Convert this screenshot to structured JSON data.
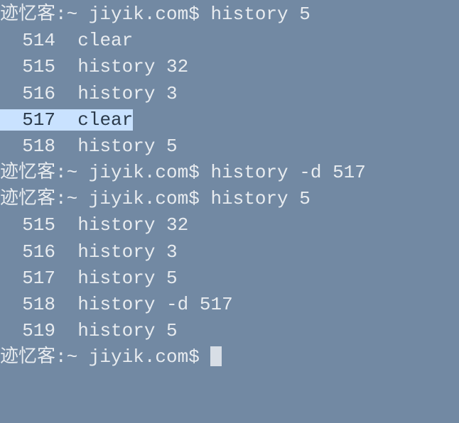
{
  "prompt": {
    "user": "迹忆客",
    "sep1": ":~ ",
    "host": "jiyik.com",
    "sep2": "$ "
  },
  "lines": [
    {
      "type": "cmd",
      "command": "history 5"
    },
    {
      "type": "hist",
      "num": "  514",
      "cmd": "clear",
      "highlight": false
    },
    {
      "type": "hist",
      "num": "  515",
      "cmd": "history 32",
      "highlight": false
    },
    {
      "type": "hist",
      "num": "  516",
      "cmd": "history 3",
      "highlight": false
    },
    {
      "type": "hist",
      "num": "  517",
      "cmd": "clear",
      "highlight": true
    },
    {
      "type": "hist",
      "num": "  518",
      "cmd": "history 5",
      "highlight": false
    },
    {
      "type": "cmd",
      "command": "history -d 517"
    },
    {
      "type": "cmd",
      "command": "history 5"
    },
    {
      "type": "hist",
      "num": "  515",
      "cmd": "history 32",
      "highlight": false
    },
    {
      "type": "hist",
      "num": "  516",
      "cmd": "history 3",
      "highlight": false
    },
    {
      "type": "hist",
      "num": "  517",
      "cmd": "history 5",
      "highlight": false
    },
    {
      "type": "hist",
      "num": "  518",
      "cmd": "history -d 517",
      "highlight": false
    },
    {
      "type": "hist",
      "num": "  519",
      "cmd": "history 5",
      "highlight": false
    },
    {
      "type": "cmd",
      "command": "",
      "cursor": true
    }
  ]
}
